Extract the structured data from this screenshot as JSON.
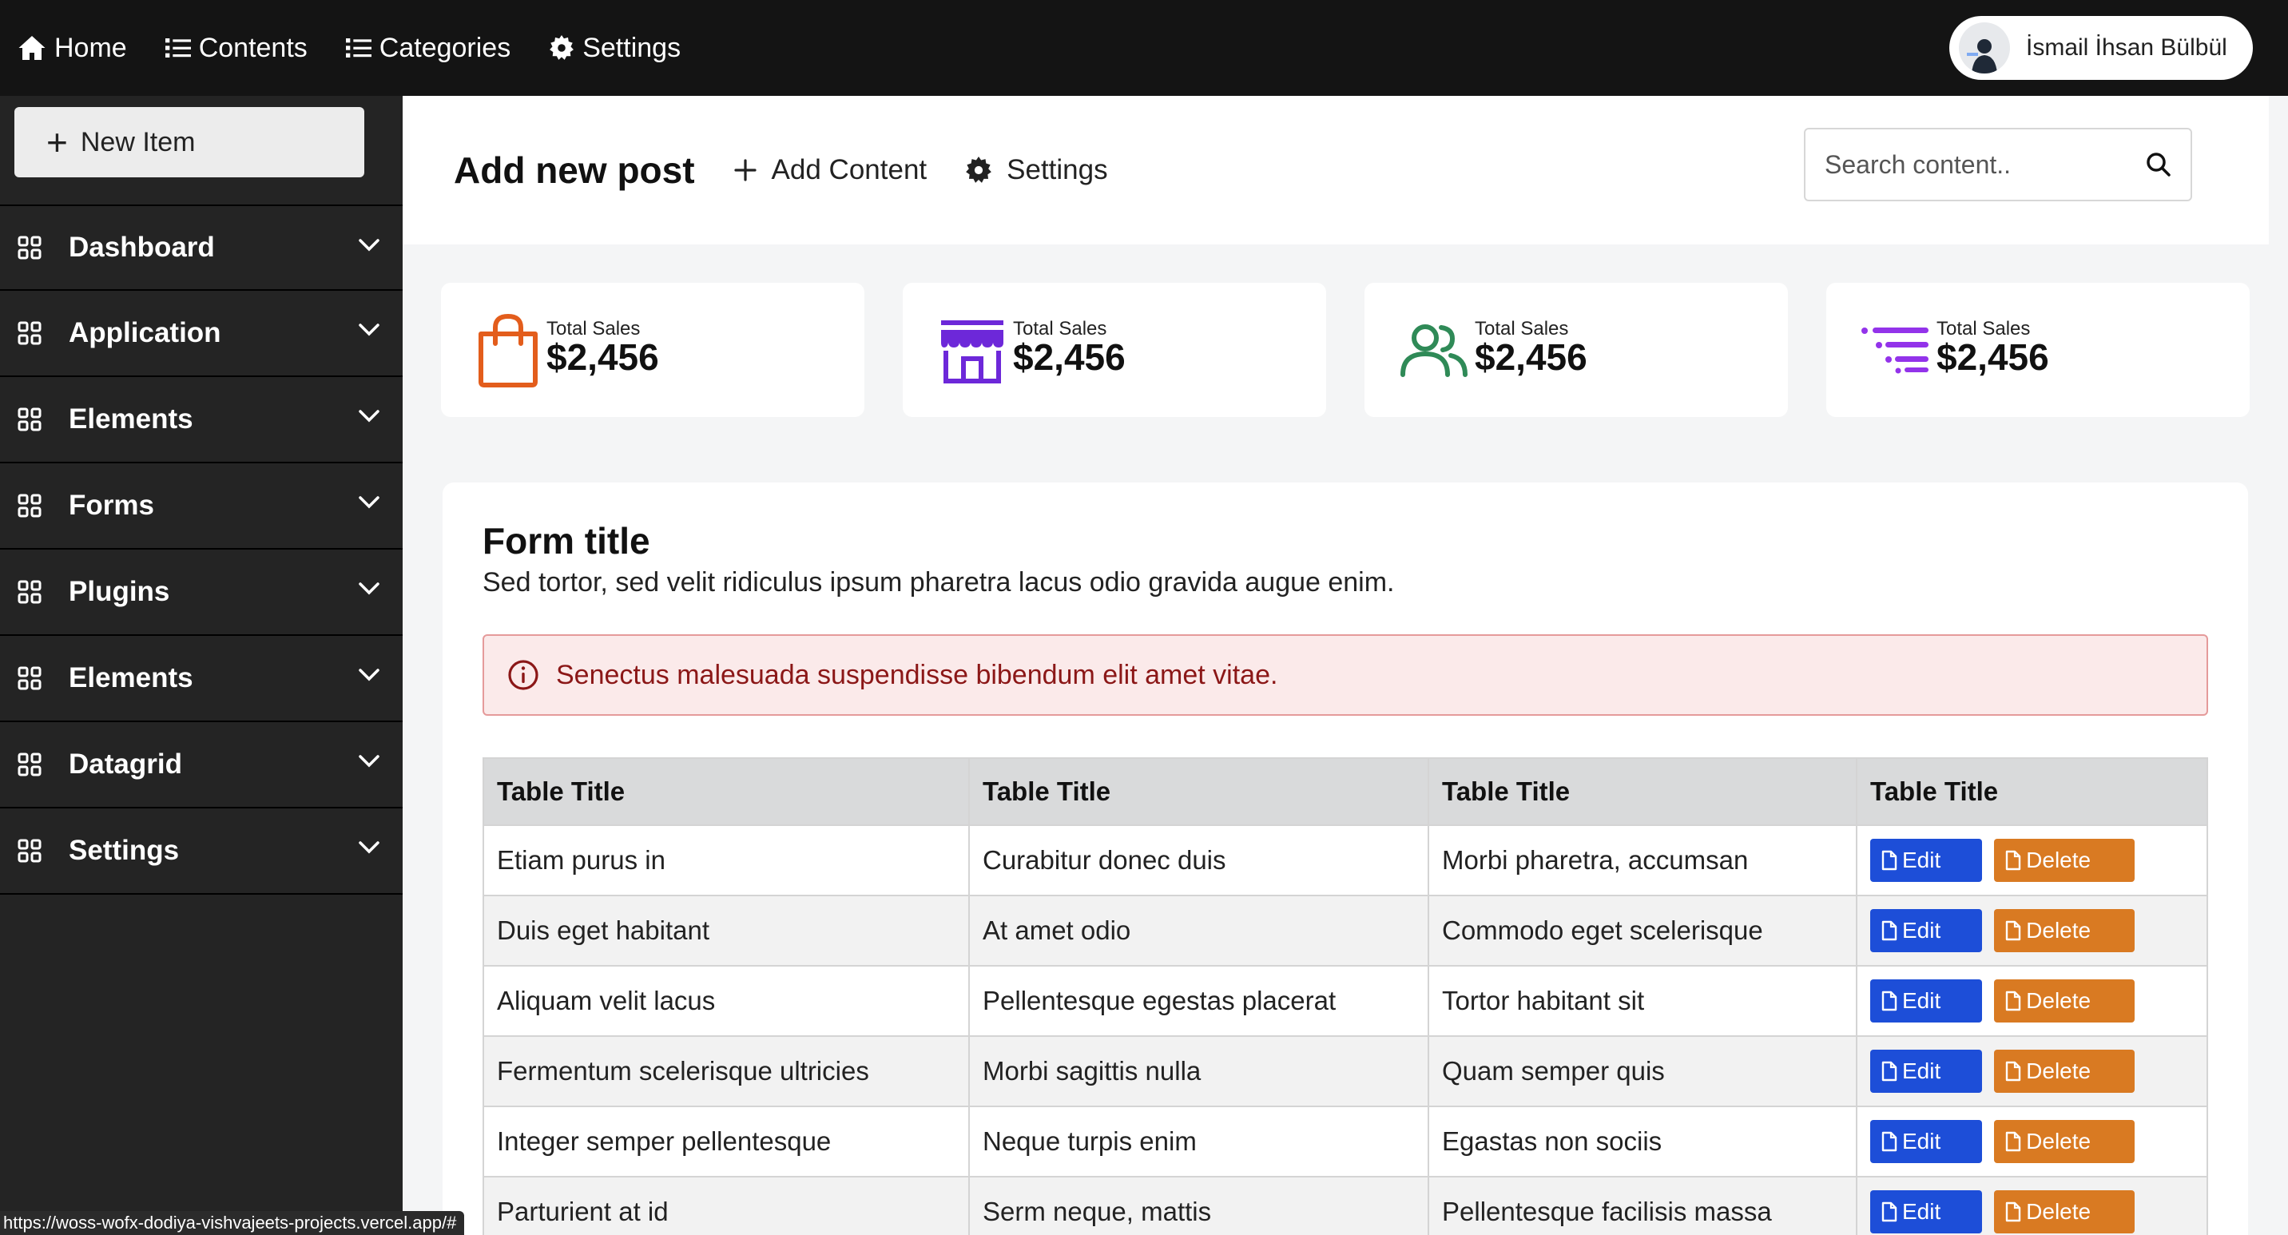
{
  "topnav": {
    "items": [
      {
        "label": "Home",
        "icon": "home-icon"
      },
      {
        "label": "Contents",
        "icon": "list-icon"
      },
      {
        "label": "Categories",
        "icon": "list-icon"
      },
      {
        "label": "Settings",
        "icon": "gear-icon"
      }
    ],
    "user_name": "İsmail İhsan Bülbül"
  },
  "sidebar": {
    "new_item_label": "New Item",
    "items": [
      {
        "label": "Dashboard"
      },
      {
        "label": "Application"
      },
      {
        "label": "Elements"
      },
      {
        "label": "Forms"
      },
      {
        "label": "Plugins"
      },
      {
        "label": "Elements"
      },
      {
        "label": "Datagrid"
      },
      {
        "label": "Settings"
      }
    ]
  },
  "header": {
    "title": "Add new post",
    "add_content_label": "Add Content",
    "settings_label": "Settings",
    "search_placeholder": "Search content.."
  },
  "stats": [
    {
      "label": "Total Sales",
      "value": "$2,456",
      "icon": "shopping-bag-icon",
      "color": "#e35d1c"
    },
    {
      "label": "Total Sales",
      "value": "$2,456",
      "icon": "store-icon",
      "color": "#6d28d9"
    },
    {
      "label": "Total Sales",
      "value": "$2,456",
      "icon": "users-icon",
      "color": "#2f8a57"
    },
    {
      "label": "Total Sales",
      "value": "$2,456",
      "icon": "list-filter-icon",
      "color": "#9333ea"
    }
  ],
  "form": {
    "title": "Form title",
    "description": "Sed tortor, sed velit ridiculus ipsum pharetra lacus odio gravida augue enim.",
    "alert": "Senectus malesuada suspendisse bibendum elit amet vitae."
  },
  "table": {
    "headers": [
      "Table Title",
      "Table Title",
      "Table Title",
      "Table Title"
    ],
    "edit_label": "Edit",
    "delete_label": "Delete",
    "rows": [
      [
        "Etiam purus in",
        "Curabitur donec duis",
        "Morbi pharetra, accumsan"
      ],
      [
        "Duis eget habitant",
        "At amet odio",
        "Commodo eget scelerisque"
      ],
      [
        "Aliquam velit lacus",
        "Pellentesque egestas placerat",
        "Tortor habitant sit"
      ],
      [
        "Fermentum scelerisque ultricies",
        "Morbi sagittis nulla",
        "Quam semper quis"
      ],
      [
        "Integer semper pellentesque",
        "Neque turpis enim",
        "Egastas non sociis"
      ],
      [
        "Parturient at id",
        "Serm neque, mattis",
        "Pellentesque facilisis massa"
      ]
    ]
  },
  "status_bar": {
    "url": "https://woss-wofx-dodiya-vishvajeets-projects.vercel.app/#"
  },
  "colors": {
    "topbar": "#141414",
    "sidebar": "#242424",
    "edit_button": "#1d4ed8",
    "delete_button": "#d97a22",
    "alert_text": "#8b1717"
  }
}
